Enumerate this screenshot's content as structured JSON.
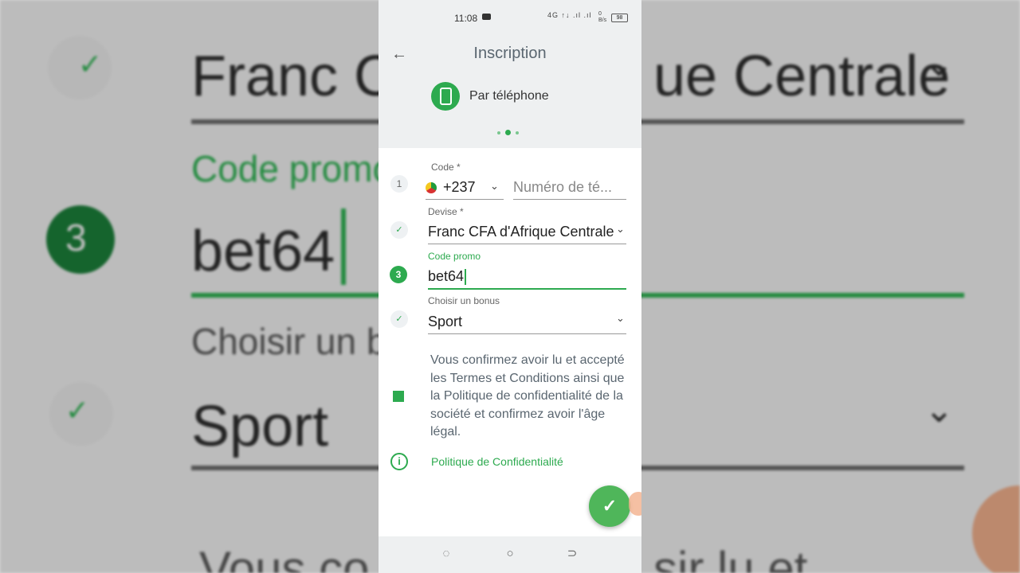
{
  "status_bar": {
    "time": "11:08",
    "signal": "4G ↑↓ .ıl .ıl",
    "net_speed": "0 B/s",
    "battery": "98"
  },
  "header": {
    "title": "Inscription"
  },
  "method": {
    "label": "Par téléphone"
  },
  "steps": {
    "one": "1",
    "three": "3",
    "check": "✓"
  },
  "form": {
    "code_label": "Code *",
    "code_value": "+237",
    "phone_placeholder": "Numéro de té...",
    "currency_label": "Devise *",
    "currency_value": "Franc CFA d'Afrique Centrale",
    "promo_label": "Code promo",
    "promo_value": "bet64",
    "bonus_label": "Choisir un bonus",
    "bonus_value": "Sport"
  },
  "terms": "Vous confirmez avoir lu et accepté les Termes et Conditions ainsi que la Politique de confidentialité de la société et confirmez avoir l'âge légal.",
  "policy_link": "Politique de Confidentialité",
  "background": {
    "currency_zoom": "Franc C",
    "currency_zoom_tail": "ue Centrale",
    "promo_label_zoom": "Code promo",
    "promo_value_zoom": "bet64",
    "bonus_label_zoom": "Choisir un b",
    "bonus_value_zoom": "Sport",
    "terms_zoom": "Vous co",
    "terms_zoom_tail": "sir lu et",
    "step_zoom": "3"
  },
  "colors": {
    "accent": "#2daa4f",
    "fab": "#4fb65a"
  }
}
